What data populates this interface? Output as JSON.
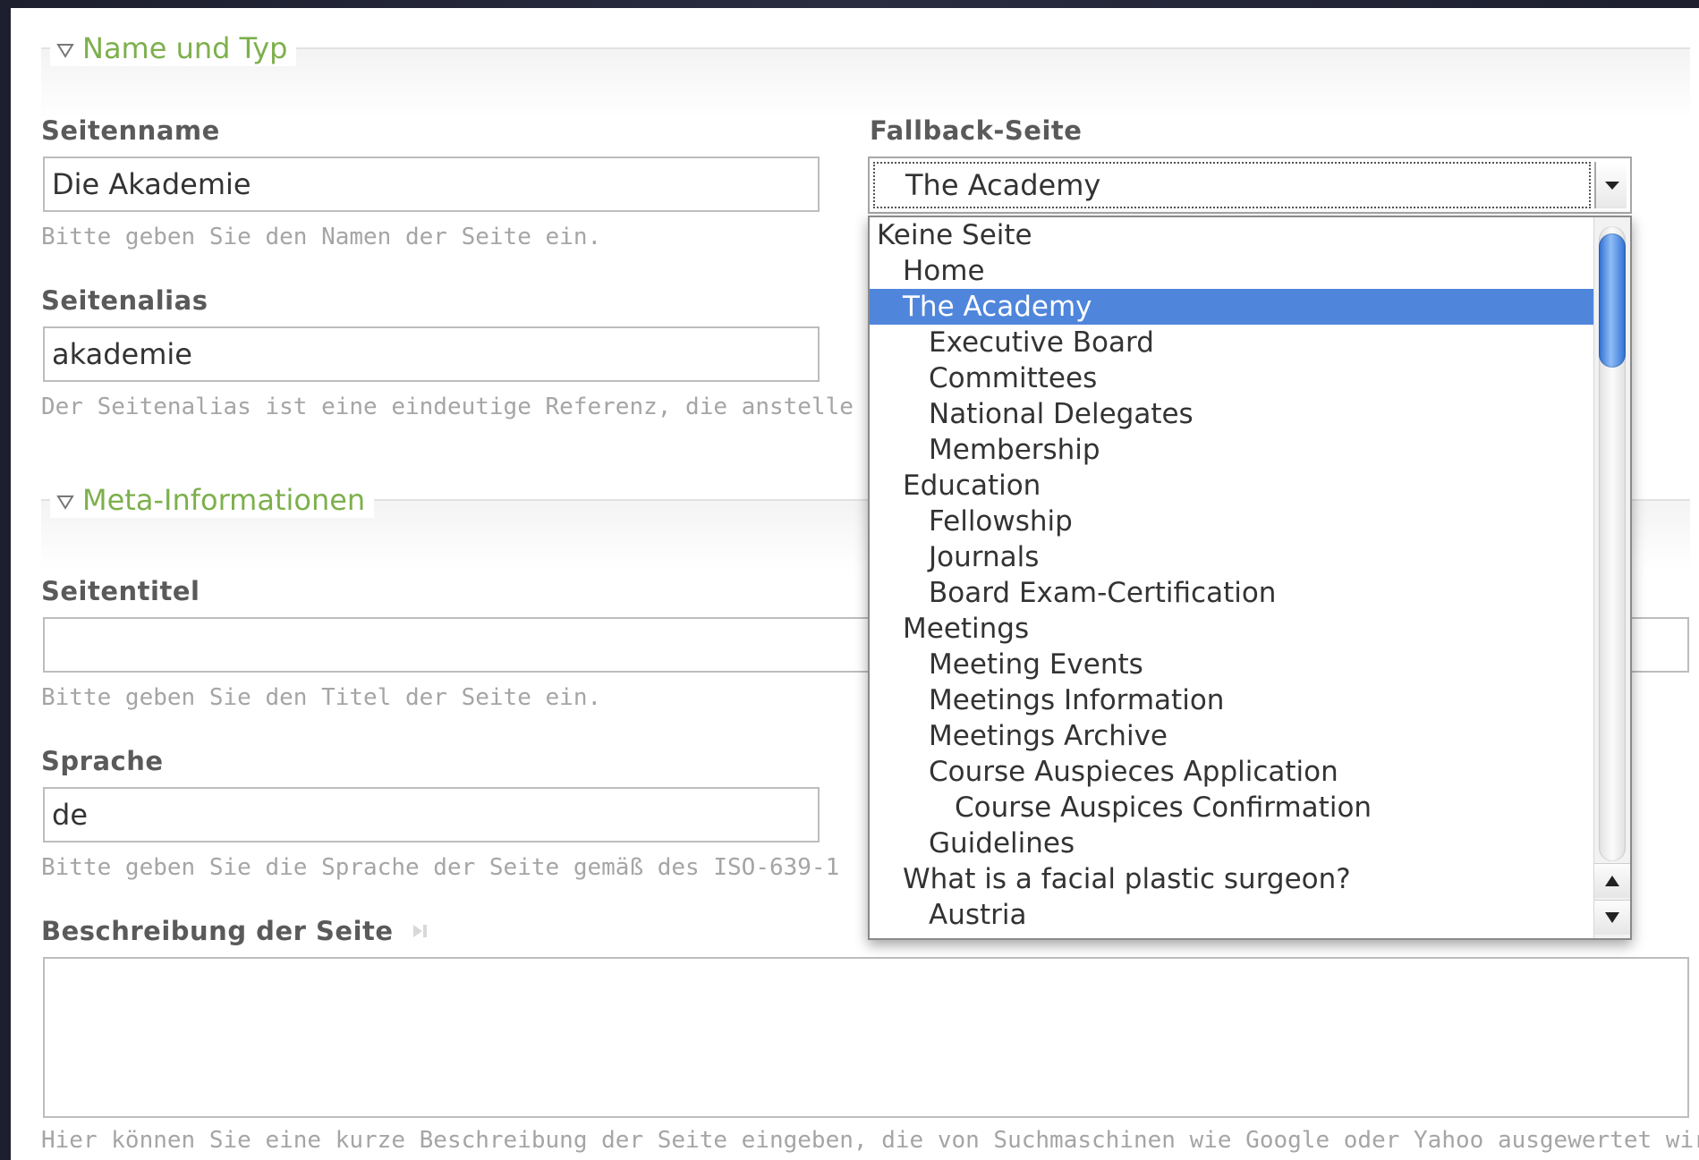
{
  "sections": {
    "name_typ": "Name und Typ",
    "meta": "Meta-Informationen"
  },
  "fields": {
    "seitenname": {
      "label": "Seitenname",
      "value": "Die Akademie",
      "hint": "Bitte geben Sie den Namen der Seite ein."
    },
    "fallback": {
      "label": "Fallback-Seite",
      "value": "The Academy"
    },
    "seitenalias": {
      "label": "Seitenalias",
      "value": "akademie",
      "hint": "Der Seitenalias ist eine eindeutige Referenz, die anstelle der"
    },
    "seitentitel": {
      "label": "Seitentitel",
      "value": "",
      "hint": "Bitte geben Sie den Titel der Seite ein."
    },
    "sprache": {
      "label": "Sprache",
      "value": "de",
      "hint": "Bitte geben Sie die Sprache der Seite gemäß des ISO-639-1"
    },
    "beschreibung": {
      "label": "Beschreibung der Seite",
      "value": "",
      "hint": "Hier können Sie eine kurze Beschreibung der Seite eingeben, die von Suchmaschinen wie Google oder Yahoo ausgewertet wird."
    }
  },
  "dropdown": {
    "options": [
      {
        "label": "Keine Seite",
        "level": 0
      },
      {
        "label": "Home",
        "level": 1
      },
      {
        "label": "The Academy",
        "level": 1,
        "selected": true
      },
      {
        "label": "Executive Board",
        "level": 2
      },
      {
        "label": "Committees",
        "level": 2
      },
      {
        "label": "National Delegates",
        "level": 2
      },
      {
        "label": "Membership",
        "level": 2
      },
      {
        "label": "Education",
        "level": 1
      },
      {
        "label": "Fellowship",
        "level": 2
      },
      {
        "label": "Journals",
        "level": 2
      },
      {
        "label": "Board Exam-Certification",
        "level": 2
      },
      {
        "label": "Meetings",
        "level": 1
      },
      {
        "label": "Meeting Events",
        "level": 2
      },
      {
        "label": "Meetings Information",
        "level": 2
      },
      {
        "label": "Meetings Archive",
        "level": 2
      },
      {
        "label": "Course Auspieces Application",
        "level": 2
      },
      {
        "label": "Course Auspices Confirmation",
        "level": 3
      },
      {
        "label": "Guidelines",
        "level": 2
      },
      {
        "label": "What is a facial plastic surgeon?",
        "level": 1
      },
      {
        "label": "Austria",
        "level": 2
      }
    ]
  },
  "colors": {
    "accent_green": "#7db04c",
    "selection_blue": "#4f86dc"
  }
}
